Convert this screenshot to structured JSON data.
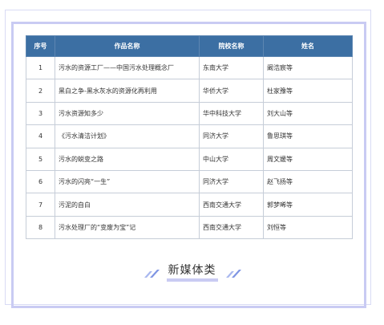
{
  "table": {
    "headers": [
      "序号",
      "作品名称",
      "院校名称",
      "姓名"
    ],
    "rows": [
      {
        "no": "1",
        "work": "污水的资源工厂——中国污水处理概念厂",
        "school": "东南大学",
        "name": "阚浩宸等"
      },
      {
        "no": "2",
        "work": "黑白之争-黑水灰水的资源化再利用",
        "school": "华侨大学",
        "name": "杜家豫等"
      },
      {
        "no": "3",
        "work": "污水资源知多少",
        "school": "华中科技大学",
        "name": "刘大山等"
      },
      {
        "no": "4",
        "work": "《污水清洁计划》",
        "school": "同济大学",
        "name": "鲁思琪等"
      },
      {
        "no": "5",
        "work": "污水的蜕变之路",
        "school": "中山大学",
        "name": "周文媛等"
      },
      {
        "no": "6",
        "work": "污水的闪亮“一生”",
        "school": "同济大学",
        "name": "赵飞扬等"
      },
      {
        "no": "7",
        "work": "污泥的自白",
        "school": "西南交通大学",
        "name": "郭梦晞等"
      },
      {
        "no": "8",
        "work": "污水处理厂的“变废为宝”记",
        "school": "西南交通大学",
        "name": "刘恒等"
      }
    ]
  },
  "section": {
    "title": "新媒体类"
  },
  "colors": {
    "header_bg": "#3c6fa3",
    "frame": "#c9cbf3",
    "accent_slash": "#8ea2e8"
  },
  "icons": {
    "left_decor": "double-slash-icon",
    "right_decor": "double-slash-icon"
  }
}
